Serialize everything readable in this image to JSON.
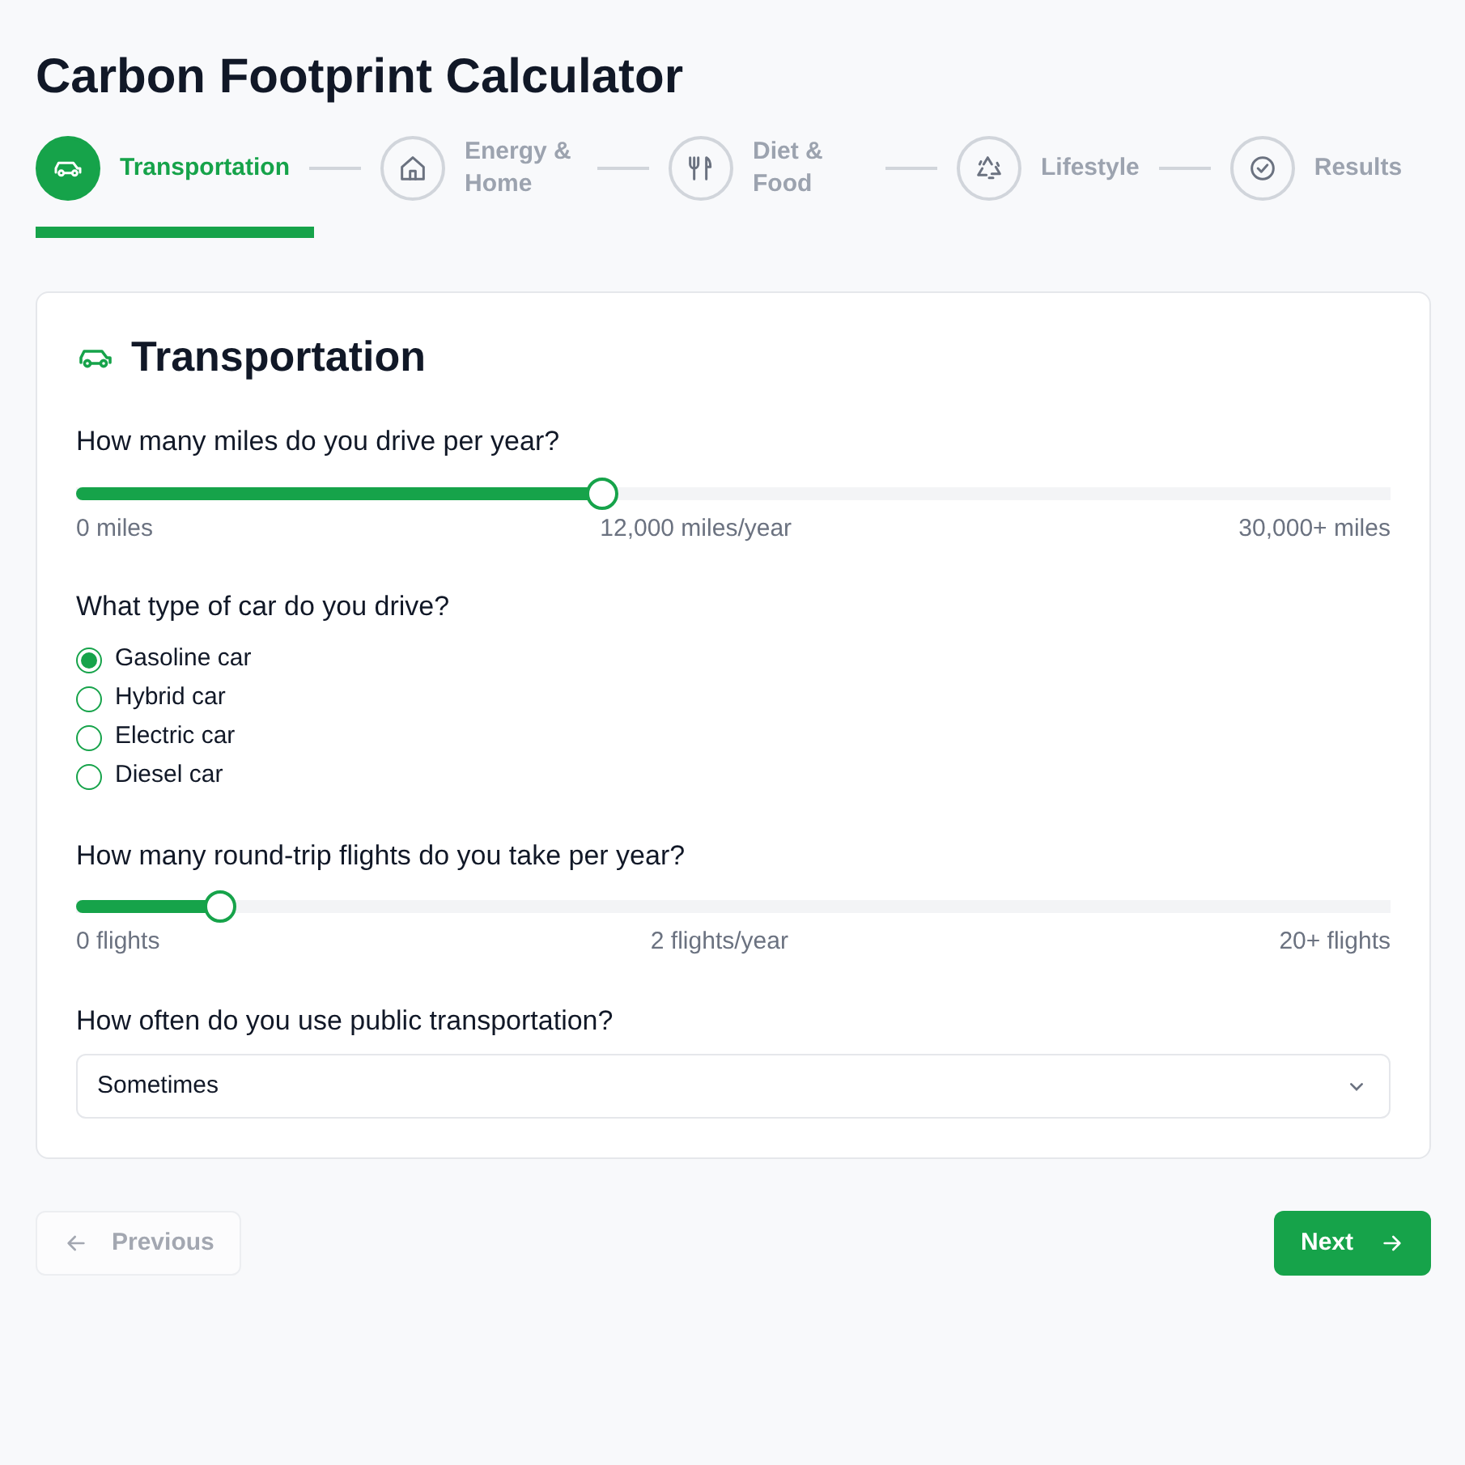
{
  "title": "Carbon Footprint Calculator",
  "steps": [
    {
      "label": "Transportation",
      "kind": "car",
      "selected": true
    },
    {
      "label": "Energy & Home",
      "kind": "home",
      "selected": false
    },
    {
      "label": "Diet & Food",
      "kind": "food",
      "selected": false
    },
    {
      "label": "Lifestyle",
      "kind": "recycle",
      "selected": false
    },
    {
      "label": "Results",
      "kind": "check",
      "selected": false
    }
  ],
  "section": {
    "title": "Transportation",
    "kind": "car"
  },
  "questions": [
    {
      "kind": "slider",
      "label": "How many miles do you drive per year?",
      "level": 0.4,
      "min_label": "0 miles",
      "reading": "12,000 miles/year",
      "max_label": "30,000+ miles"
    },
    {
      "kind": "radio",
      "label": "What type of car do you drive?",
      "options": [
        {
          "label": "Gasoline car",
          "selected": true
        },
        {
          "label": "Hybrid car",
          "selected": false
        },
        {
          "label": "Electric car",
          "selected": false
        },
        {
          "label": "Diesel car",
          "selected": false
        }
      ]
    },
    {
      "kind": "slider",
      "label": "How many round-trip flights do you take per year?",
      "level": 0.11,
      "min_label": "0 flights",
      "reading": "2 flights/year",
      "max_label": "20+ flights"
    },
    {
      "kind": "select",
      "label": "How often do you use public transportation?",
      "value": "Sometimes"
    }
  ],
  "buttons": {
    "previous": {
      "label": "Previous",
      "disabled": true
    },
    "next": {
      "label": "Next",
      "disabled": false
    }
  }
}
